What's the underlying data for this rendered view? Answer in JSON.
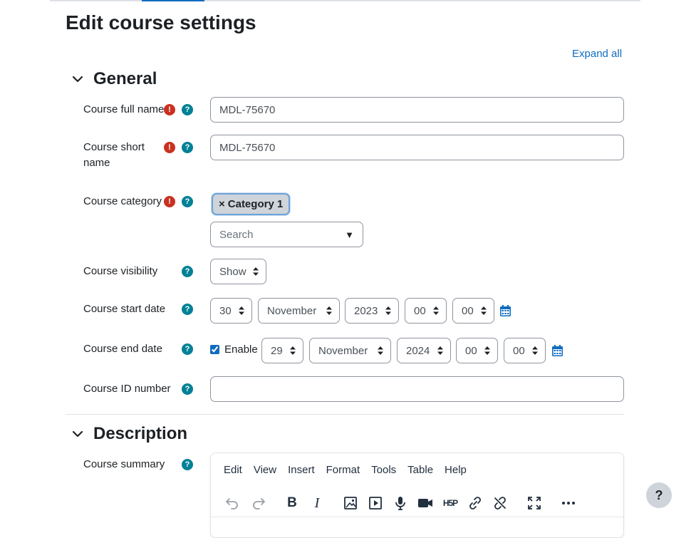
{
  "page": {
    "title": "Edit course settings",
    "expand_all": "Expand all"
  },
  "colors": {
    "accent": "#0f6cbf",
    "required": "#ca3120",
    "help": "#008196",
    "border": "#8f959e"
  },
  "sections": {
    "general": "General",
    "description": "Description"
  },
  "fields": {
    "fullname": {
      "label": "Course full name",
      "value": "MDL-75670"
    },
    "shortname": {
      "label_line1": "Course short",
      "label_line2": "name",
      "value": "MDL-75670"
    },
    "category": {
      "label": "Course category",
      "selected": "Category 1",
      "remove_symbol": "×",
      "search_placeholder": "Search",
      "dropdown_symbol": "▼"
    },
    "visibility": {
      "label": "Course visibility",
      "value": "Show"
    },
    "startdate": {
      "label": "Course start date",
      "day": "30",
      "month": "November",
      "year": "2023",
      "hour": "00",
      "minute": "00"
    },
    "enddate": {
      "label": "Course end date",
      "enable_label": "Enable",
      "enabled": true,
      "day": "29",
      "month": "November",
      "year": "2024",
      "hour": "00",
      "minute": "00"
    },
    "idnumber": {
      "label": "Course ID number",
      "value": ""
    },
    "summary": {
      "label": "Course summary"
    }
  },
  "icons": {
    "required": "!",
    "help": "?",
    "calendar": "calendar-icon"
  },
  "editor": {
    "menu": [
      "Edit",
      "View",
      "Insert",
      "Format",
      "Tools",
      "Table",
      "Help"
    ],
    "toolbar": [
      "undo-icon",
      "redo-icon",
      "bold-icon",
      "italic-icon",
      "image-icon",
      "media-icon",
      "microphone-icon",
      "video-camera-icon",
      "h5p-icon",
      "link-icon",
      "unlink-icon",
      "fullscreen-icon",
      "more-icon"
    ],
    "bold_glyph": "B",
    "italic_glyph": "I",
    "h5p_glyph": "H5P"
  },
  "help_button": "?"
}
